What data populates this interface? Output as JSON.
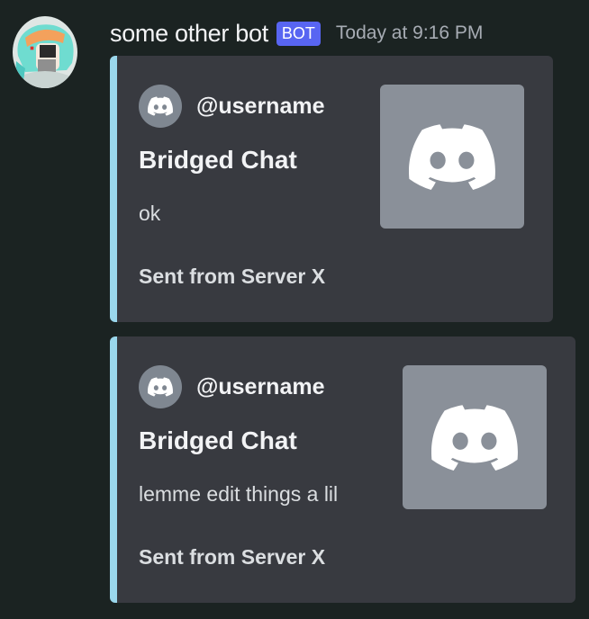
{
  "message": {
    "username": "some other bot",
    "bot_tag": "BOT",
    "timestamp": "Today at 9:16 PM"
  },
  "embeds": [
    {
      "author": "@username",
      "title": "Bridged Chat",
      "description": "ok",
      "footer": "Sent from Server X"
    },
    {
      "author": "@username",
      "title": "Bridged Chat",
      "description": "lemme edit things a lil",
      "footer": "Sent from Server X"
    }
  ],
  "colors": {
    "background": "#1b2322",
    "embed_background": "#383a40",
    "embed_accent": "#9ad7ec",
    "bot_tag": "#5865f2",
    "thumbnail": "#8a9099"
  },
  "icons": {
    "avatar": "anime-character-avatar",
    "author_icon": "discord-logo-icon",
    "thumbnail": "discord-logo-icon"
  }
}
